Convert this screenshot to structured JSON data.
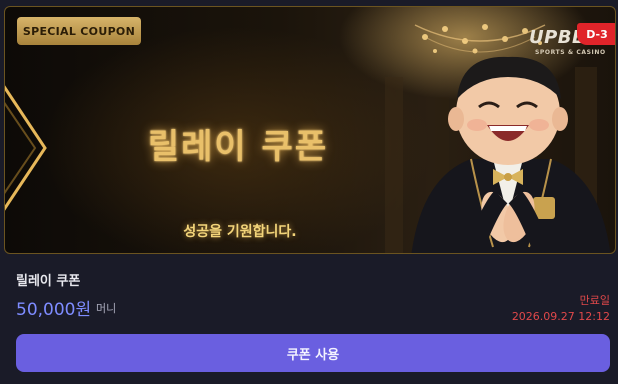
{
  "banner": {
    "tag_label": "SPECIAL COUPON",
    "title": "릴레이 쿠폰",
    "subtitle": "성공을 기원합니다.",
    "brand_name": "UPBET",
    "brand_tagline": "SPORTS & CASINO",
    "dday_badge": "D-3"
  },
  "coupon": {
    "name": "릴레이 쿠폰",
    "amount": "50,000원",
    "amount_unit": "머니",
    "expiry_label": "만료일",
    "expiry_date": "2026.09.27 12:12"
  },
  "action": {
    "use_label": "쿠폰 사용"
  },
  "colors": {
    "accent": "#6a5fe0",
    "amount": "#7e8cff",
    "expiry": "#e0484a",
    "gold": "#e9c06a",
    "badge": "#e0242a"
  }
}
